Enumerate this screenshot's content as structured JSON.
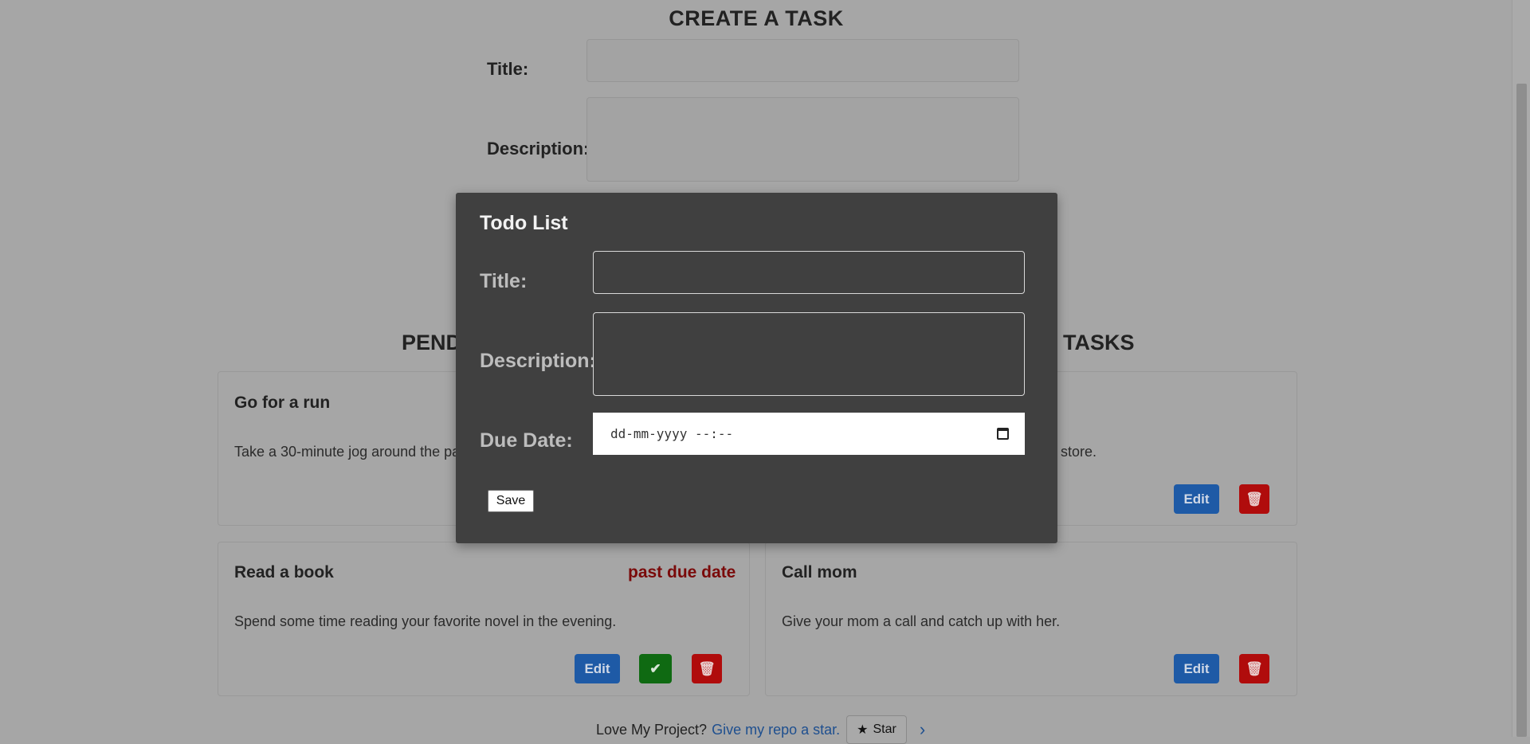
{
  "create_form": {
    "heading": "CREATE A TASK",
    "title_label": "Title:",
    "description_label": "Description:"
  },
  "sections": {
    "pending_partial": "PEND",
    "completed_partial": "TASKS"
  },
  "cards": [
    {
      "title": "Go for a run",
      "description": "Take a 30-minute jog around the par",
      "edit_label": "",
      "status": ""
    },
    {
      "title": "",
      "description": "he store.",
      "edit_label": "Edit",
      "status": ""
    },
    {
      "title": "Read a book",
      "description": "Spend some time reading your favorite novel in the evening.",
      "edit_label": "Edit",
      "status": "past due date"
    },
    {
      "title": "Call mom",
      "description": "Give your mom a call and catch up with her.",
      "edit_label": "Edit",
      "status": ""
    }
  ],
  "icons": {
    "done": "check-icon",
    "delete": "trash-icon",
    "star": "star-icon",
    "next": "chevron-right-icon",
    "date": "calendar-icon"
  },
  "footer": {
    "text": "Love My Project?",
    "link": "Give my repo a star.",
    "star_label": "Star",
    "chevron": "›"
  },
  "modal": {
    "title": "Todo List",
    "title_label": "Title:",
    "description_label": "Description:",
    "due_date_label": "Due Date:",
    "due_date_placeholder": "dd-mm-yyyy --:--",
    "save_label": "Save"
  },
  "colors": {
    "overlay_bg": "#a6a6a6",
    "modal_bg": "#404040",
    "edit": "#1e5aa6",
    "done": "#0f6a12",
    "delete": "#b00c0c",
    "past_due": "#7a0a0a"
  }
}
